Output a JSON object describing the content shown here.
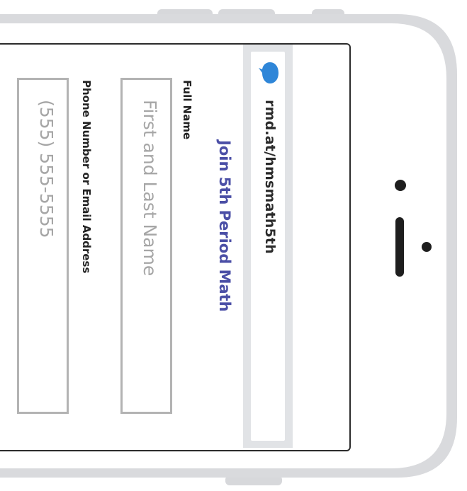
{
  "browser": {
    "url": "rmd.at/hmsmath5th",
    "logo_icon": "remind-chat-bubble-icon"
  },
  "form": {
    "title": "Join 5th Period Math",
    "full_name_label": "Full Name",
    "full_name_placeholder": "First and Last Name",
    "contact_label": "Phone Number or Email Address",
    "contact_placeholder": "(555) 555-5555"
  },
  "colors": {
    "title_accent": "#4b4fa6",
    "logo_blue": "#2f86d8",
    "phone_frame": "#d9dadd",
    "input_border": "#b3b3b3",
    "placeholder": "#a6a6a6"
  }
}
